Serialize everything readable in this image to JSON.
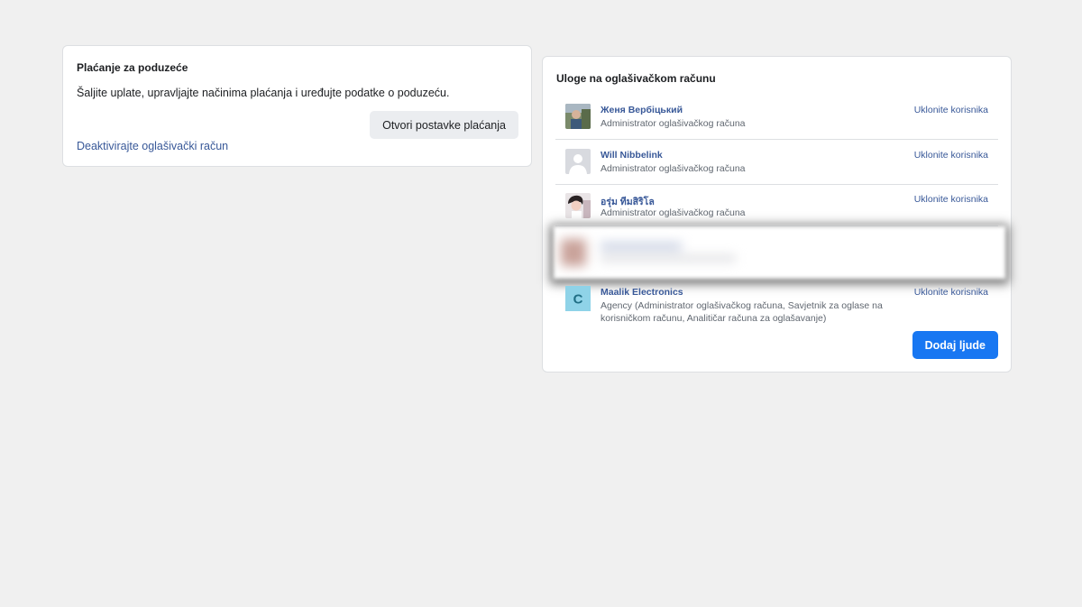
{
  "payment": {
    "title": "Plaćanje za poduzeće",
    "description": "Šaljite uplate, upravljajte načinima plaćanja i uređujte podatke o poduzeću.",
    "open_settings_label": "Otvori postavke plaćanja",
    "deactivate_label": "Deaktivirajte oglašivački račun"
  },
  "roles": {
    "title": "Uloge na oglašivačkom računu",
    "remove_label": "Uklonite korisnika",
    "add_people_label": "Dodaj ljude",
    "members": [
      {
        "name": "Женя Вербіцький",
        "role": "Administrator oglašivačkog računa",
        "remove": "Uklonite korisnika",
        "avatar": "photo-avatar"
      },
      {
        "name": "Will Nibbelink",
        "role": "Administrator oglašivačkog računa",
        "remove": "Uklonite korisnika",
        "avatar": "default-user-avatar"
      },
      {
        "name": "อรุ่ม ทีมสิริโล",
        "role": "Administrator oglašivačkog računa",
        "remove": "Uklonite korisnika",
        "avatar": "photo-avatar"
      },
      {
        "name": "",
        "role": "",
        "remove": "",
        "avatar": "blurred-avatar",
        "blurred": true
      },
      {
        "name": "Maalik Electronics",
        "role": "Agency (Administrator oglašivačkog računa, Savjetnik za oglase na korisničkom računu, Analitičar računa za oglašavanje)",
        "remove": "Uklonite korisnika",
        "avatar": "letter-avatar",
        "avatar_letter": "C"
      }
    ]
  },
  "colors": {
    "background": "#f0f0f0",
    "link": "#385898",
    "primary_button": "#1877f2",
    "secondary_button": "#ebedf0",
    "letter_avatar_bg": "#8fd3e8",
    "letter_avatar_fg": "#1f6e85"
  }
}
